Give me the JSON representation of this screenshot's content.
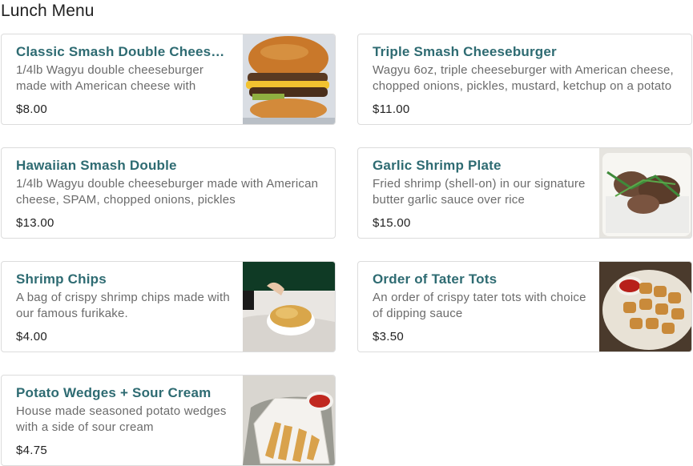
{
  "page": {
    "title": "Lunch Menu"
  },
  "items": [
    {
      "name": "Classic Smash Double Cheeseburger",
      "description": "1/4lb Wagyu double cheeseburger made with American cheese with chopped onions, pickles, mustard, ketchup on a potato bun",
      "price": "$8.00",
      "image": "burger-photo"
    },
    {
      "name": "Triple Smash Cheeseburger",
      "description": "Wagyu 6oz, triple cheeseburger with American cheese, chopped onions, pickles, mustard, ketchup on a potato bun",
      "price": "$11.00",
      "image": ""
    },
    {
      "name": "Hawaiian Smash Double",
      "description": "1/4lb Wagyu double cheeseburger made with American cheese, SPAM, chopped onions, pickles",
      "price": "$13.00",
      "image": ""
    },
    {
      "name": "Garlic Shrimp Plate",
      "description": "Fried shrimp (shell-on) in our signature butter garlic sauce over rice",
      "price": "$15.00",
      "image": "shrimp-plate-photo"
    },
    {
      "name": "Shrimp Chips",
      "description": "A bag of crispy shrimp chips made with our famous furikake.",
      "price": "$4.00",
      "image": "shrimp-chips-photo"
    },
    {
      "name": "Order of Tater Tots",
      "description": "An order of crispy tater tots with choice of dipping sauce",
      "price": "$3.50",
      "image": "tater-tots-photo"
    },
    {
      "name": "Potato Wedges + Sour Cream",
      "description": "House made seasoned potato wedges with a side of sour cream",
      "price": "$4.75",
      "image": "potato-wedges-photo"
    }
  ],
  "colors": {
    "accent": "#2e6b72",
    "border": "#dcdcdc",
    "desc": "#6b6b6b"
  }
}
